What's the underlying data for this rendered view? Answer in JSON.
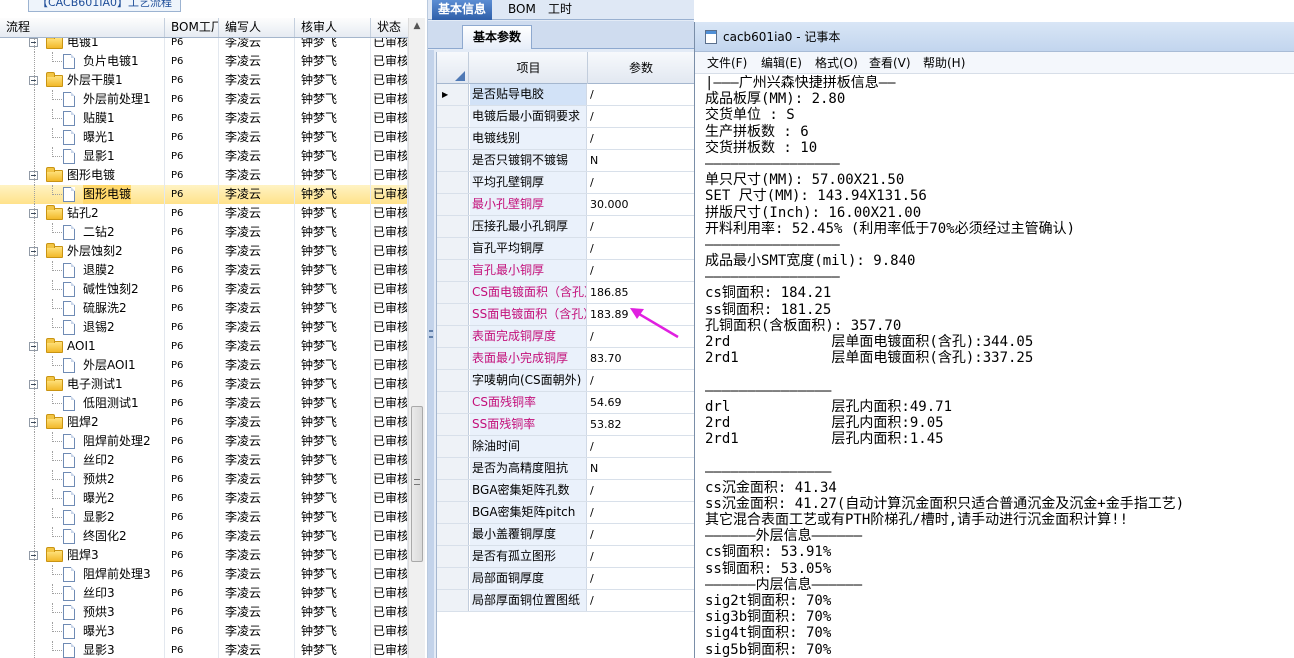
{
  "left": {
    "caption": "【CACB601IA0】工艺流程",
    "columns": [
      "流程",
      "BOM工厂",
      "编写人",
      "核审人",
      "状态"
    ],
    "rows": [
      {
        "level": 1,
        "type": "folder",
        "name": "电镀1",
        "bom": "P6",
        "author": "李凌云",
        "reviewer": "钟梦飞",
        "status": "已审核"
      },
      {
        "level": 2,
        "type": "doc",
        "name": "负片电镀1",
        "bom": "P6",
        "author": "李凌云",
        "reviewer": "钟梦飞",
        "status": "已审核"
      },
      {
        "level": 1,
        "type": "folder",
        "name": "外层干膜1",
        "bom": "P6",
        "author": "李凌云",
        "reviewer": "钟梦飞",
        "status": "已审核"
      },
      {
        "level": 2,
        "type": "doc",
        "name": "外层前处理1",
        "bom": "P6",
        "author": "李凌云",
        "reviewer": "钟梦飞",
        "status": "已审核"
      },
      {
        "level": 2,
        "type": "doc",
        "name": "贴膜1",
        "bom": "P6",
        "author": "李凌云",
        "reviewer": "钟梦飞",
        "status": "已审核"
      },
      {
        "level": 2,
        "type": "doc",
        "name": "曝光1",
        "bom": "P6",
        "author": "李凌云",
        "reviewer": "钟梦飞",
        "status": "已审核"
      },
      {
        "level": 2,
        "type": "doc",
        "name": "显影1",
        "bom": "P6",
        "author": "李凌云",
        "reviewer": "钟梦飞",
        "status": "已审核"
      },
      {
        "level": 1,
        "type": "folder",
        "name": "图形电镀",
        "bom": "P6",
        "author": "李凌云",
        "reviewer": "钟梦飞",
        "status": "已审核"
      },
      {
        "level": 2,
        "type": "doc",
        "name": "图形电镀",
        "bom": "P6",
        "author": "李凌云",
        "reviewer": "钟梦飞",
        "status": "已审核",
        "selected": true
      },
      {
        "level": 1,
        "type": "folder",
        "name": "钻孔2",
        "bom": "P6",
        "author": "李凌云",
        "reviewer": "钟梦飞",
        "status": "已审核"
      },
      {
        "level": 2,
        "type": "doc",
        "name": "二钻2",
        "bom": "P6",
        "author": "李凌云",
        "reviewer": "钟梦飞",
        "status": "已审核"
      },
      {
        "level": 1,
        "type": "folder",
        "name": "外层蚀刻2",
        "bom": "P6",
        "author": "李凌云",
        "reviewer": "钟梦飞",
        "status": "已审核"
      },
      {
        "level": 2,
        "type": "doc",
        "name": "退膜2",
        "bom": "P6",
        "author": "李凌云",
        "reviewer": "钟梦飞",
        "status": "已审核"
      },
      {
        "level": 2,
        "type": "doc",
        "name": "碱性蚀刻2",
        "bom": "P6",
        "author": "李凌云",
        "reviewer": "钟梦飞",
        "status": "已审核"
      },
      {
        "level": 2,
        "type": "doc",
        "name": "硫脲洗2",
        "bom": "P6",
        "author": "李凌云",
        "reviewer": "钟梦飞",
        "status": "已审核"
      },
      {
        "level": 2,
        "type": "doc",
        "name": "退锡2",
        "bom": "P6",
        "author": "李凌云",
        "reviewer": "钟梦飞",
        "status": "已审核"
      },
      {
        "level": 1,
        "type": "folder",
        "name": "AOI1",
        "bom": "P6",
        "author": "李凌云",
        "reviewer": "钟梦飞",
        "status": "已审核"
      },
      {
        "level": 2,
        "type": "doc",
        "name": "外层AOI1",
        "bom": "P6",
        "author": "李凌云",
        "reviewer": "钟梦飞",
        "status": "已审核"
      },
      {
        "level": 1,
        "type": "folder",
        "name": "电子测试1",
        "bom": "P6",
        "author": "李凌云",
        "reviewer": "钟梦飞",
        "status": "已审核"
      },
      {
        "level": 2,
        "type": "doc",
        "name": "低阻测试1",
        "bom": "P6",
        "author": "李凌云",
        "reviewer": "钟梦飞",
        "status": "已审核"
      },
      {
        "level": 1,
        "type": "folder",
        "name": "阻焊2",
        "bom": "P6",
        "author": "李凌云",
        "reviewer": "钟梦飞",
        "status": "已审核"
      },
      {
        "level": 2,
        "type": "doc",
        "name": "阻焊前处理2",
        "bom": "P6",
        "author": "李凌云",
        "reviewer": "钟梦飞",
        "status": "已审核"
      },
      {
        "level": 2,
        "type": "doc",
        "name": "丝印2",
        "bom": "P6",
        "author": "李凌云",
        "reviewer": "钟梦飞",
        "status": "已审核"
      },
      {
        "level": 2,
        "type": "doc",
        "name": "预烘2",
        "bom": "P6",
        "author": "李凌云",
        "reviewer": "钟梦飞",
        "status": "已审核"
      },
      {
        "level": 2,
        "type": "doc",
        "name": "曝光2",
        "bom": "P6",
        "author": "李凌云",
        "reviewer": "钟梦飞",
        "status": "已审核"
      },
      {
        "level": 2,
        "type": "doc",
        "name": "显影2",
        "bom": "P6",
        "author": "李凌云",
        "reviewer": "钟梦飞",
        "status": "已审核"
      },
      {
        "level": 2,
        "type": "doc",
        "name": "终固化2",
        "bom": "P6",
        "author": "李凌云",
        "reviewer": "钟梦飞",
        "status": "已审核"
      },
      {
        "level": 1,
        "type": "folder",
        "name": "阻焊3",
        "bom": "P6",
        "author": "李凌云",
        "reviewer": "钟梦飞",
        "status": "已审核"
      },
      {
        "level": 2,
        "type": "doc",
        "name": "阻焊前处理3",
        "bom": "P6",
        "author": "李凌云",
        "reviewer": "钟梦飞",
        "status": "已审核"
      },
      {
        "level": 2,
        "type": "doc",
        "name": "丝印3",
        "bom": "P6",
        "author": "李凌云",
        "reviewer": "钟梦飞",
        "status": "已审核"
      },
      {
        "level": 2,
        "type": "doc",
        "name": "预烘3",
        "bom": "P6",
        "author": "李凌云",
        "reviewer": "钟梦飞",
        "status": "已审核"
      },
      {
        "level": 2,
        "type": "doc",
        "name": "曝光3",
        "bom": "P6",
        "author": "李凌云",
        "reviewer": "钟梦飞",
        "status": "已审核"
      },
      {
        "level": 2,
        "type": "doc",
        "name": "显影3",
        "bom": "P6",
        "author": "李凌云",
        "reviewer": "钟梦飞",
        "status": "已审核"
      }
    ]
  },
  "middle": {
    "tabs": [
      "基本信息",
      "BOM",
      "工时"
    ],
    "active_tab": 0,
    "subtab": "基本参数",
    "columns": [
      "项目",
      "参数"
    ],
    "highlight_color": "#c3107a",
    "rows": [
      {
        "item": "是否贴导电胶",
        "value": "/",
        "pink": false
      },
      {
        "item": "电镀后最小面铜要求",
        "value": "/",
        "pink": false
      },
      {
        "item": "电镀线别",
        "value": "/",
        "pink": false
      },
      {
        "item": "是否只镀铜不镀锡",
        "value": "N",
        "pink": false
      },
      {
        "item": "平均孔壁铜厚",
        "value": "/",
        "pink": false
      },
      {
        "item": "最小孔壁铜厚",
        "value": "30.000",
        "pink": true
      },
      {
        "item": "压接孔最小孔铜厚",
        "value": "/",
        "pink": false
      },
      {
        "item": "盲孔平均铜厚",
        "value": "/",
        "pink": false
      },
      {
        "item": "盲孔最小铜厚",
        "value": "/",
        "pink": true
      },
      {
        "item": "CS面电镀面积（含孔）",
        "value": "186.85",
        "pink": true
      },
      {
        "item": "SS面电镀面积（含孔）",
        "value": "183.89",
        "pink": true
      },
      {
        "item": "表面完成铜厚度",
        "value": "/",
        "pink": true
      },
      {
        "item": "表面最小完成铜厚",
        "value": "83.70",
        "pink": true
      },
      {
        "item": "字唛朝向(CS面朝外)",
        "value": "/",
        "pink": false
      },
      {
        "item": "CS面残铜率",
        "value": "54.69",
        "pink": true
      },
      {
        "item": "SS面残铜率",
        "value": "53.82",
        "pink": true
      },
      {
        "item": "除油时间",
        "value": "/",
        "pink": false
      },
      {
        "item": "是否为高精度阻抗",
        "value": "N",
        "pink": false
      },
      {
        "item": "BGA密集矩阵孔数",
        "value": "/",
        "pink": false
      },
      {
        "item": "BGA密集矩阵pitch",
        "value": "/",
        "pink": false
      },
      {
        "item": "最小盖覆铜厚度",
        "value": "/",
        "pink": false
      },
      {
        "item": "是否有孤立图形",
        "value": "/",
        "pink": false
      },
      {
        "item": "局部面铜厚度",
        "value": "/",
        "pink": false
      },
      {
        "item": "局部厚面铜位置图纸",
        "value": "/",
        "pink": false
      }
    ]
  },
  "notepad": {
    "title": "cacb601ia0 - 记事本",
    "menu": [
      "文件(F)",
      "编辑(E)",
      "格式(O)",
      "查看(V)",
      "帮助(H)"
    ],
    "lines": [
      "|———广州兴森快捷拼板信息——",
      "成品板厚(MM): 2.80",
      "交货单位 : S",
      "生产拼板数 : 6",
      "交货拼板数 : 10",
      "————————————————",
      "单只尺寸(MM): 57.00X21.50",
      "SET 尺寸(MM): 143.94X131.56",
      "拼版尺寸(Inch): 16.00X21.00",
      "开料利用率: 52.45% (利用率低于70%必须经过主管确认)",
      "————————————————",
      "成品最小SMT宽度(mil): 9.840",
      "————————————————",
      "cs铜面积: 184.21",
      "ss铜面积: 181.25",
      "孔铜面积(含板面积): 357.70",
      "2rd            层单面电镀面积(含孔):344.05",
      "2rd1           层单面电镀面积(含孔):337.25",
      "",
      "———————————————",
      "drl            层孔内面积:49.71",
      "2rd            层孔内面积:9.05",
      "2rd1           层孔内面积:1.45",
      "",
      "———————————————",
      "cs沉金面积: 41.34",
      "ss沉金面积: 41.27(自动计算沉金面积只适合普通沉金及沉金+金手指工艺)",
      "其它混合表面工艺或有PTH阶梯孔/槽时,请手动进行沉金面积计算!!",
      "——————外层信息——————",
      "cs铜面积: 53.91%",
      "ss铜面积: 53.05%",
      "——————内层信息——————",
      "sig2t铜面积: 70%",
      "sig3b铜面积: 70%",
      "sig4t铜面积: 70%",
      "sig5b铜面积: 70%"
    ]
  }
}
